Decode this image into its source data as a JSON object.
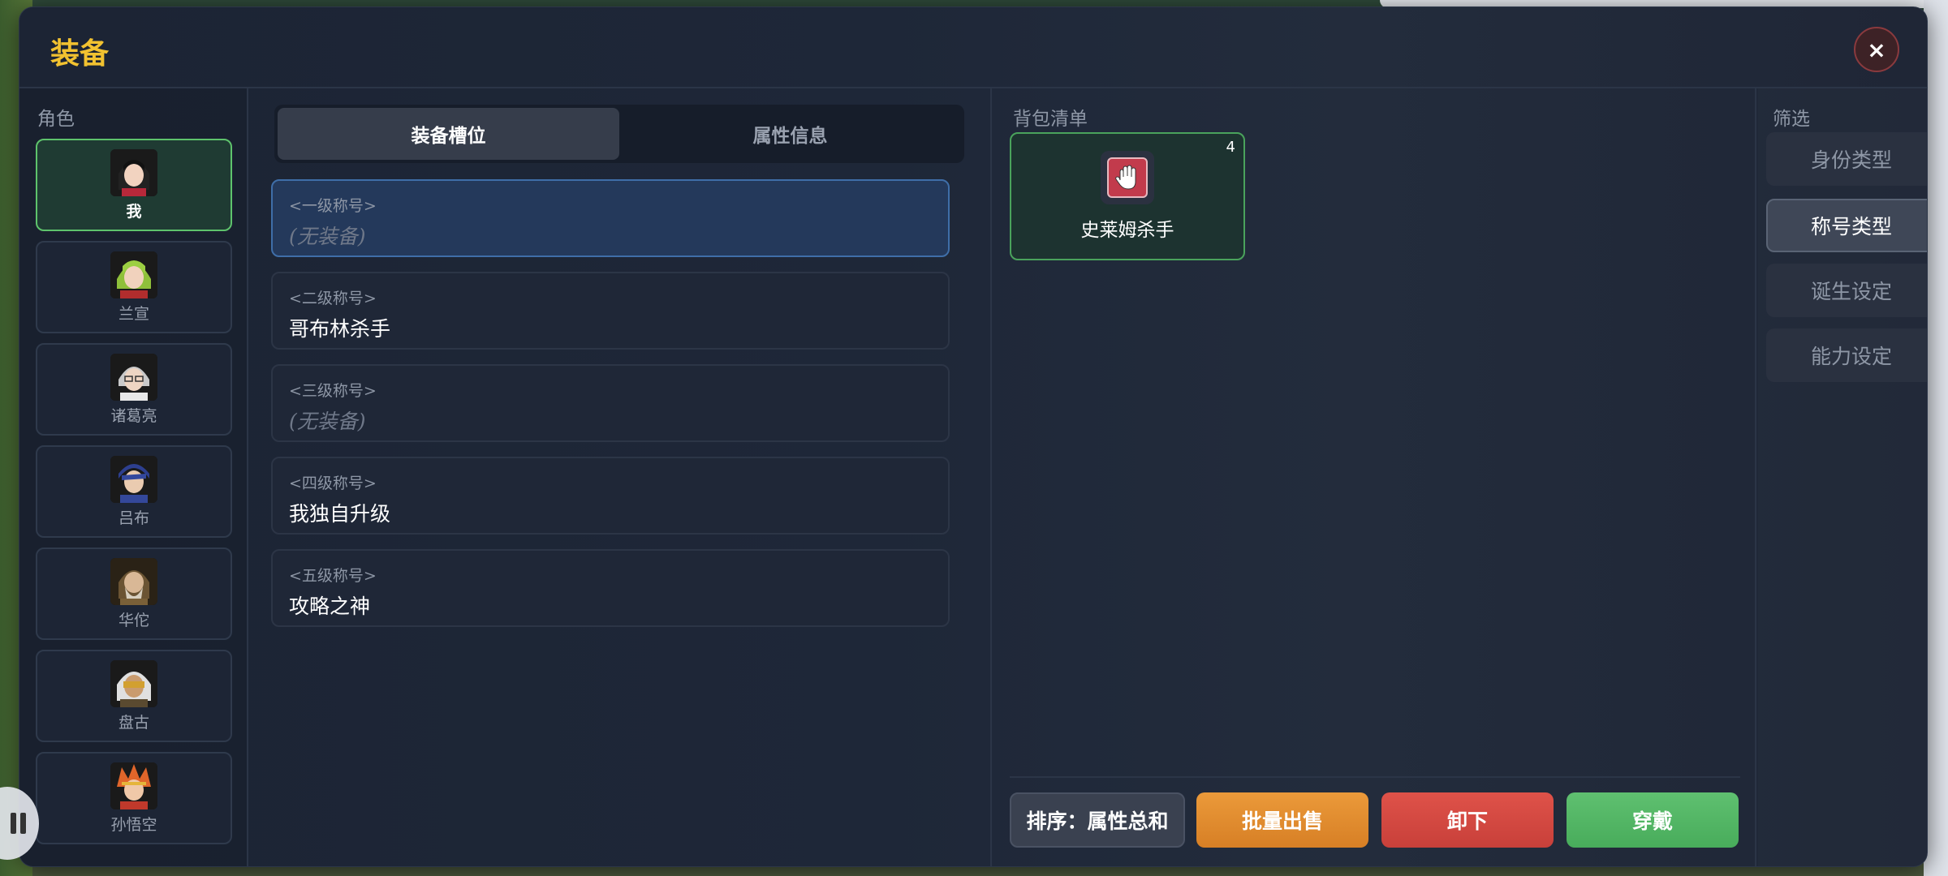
{
  "dialog": {
    "title": "装备",
    "close_label": "×"
  },
  "roles": {
    "label": "角色",
    "items": [
      {
        "name": "我",
        "active": true
      },
      {
        "name": "兰宣",
        "active": false
      },
      {
        "name": "诸葛亮",
        "active": false
      },
      {
        "name": "吕布",
        "active": false
      },
      {
        "name": "华佗",
        "active": false
      },
      {
        "name": "盘古",
        "active": false
      },
      {
        "name": "孙悟空",
        "active": false
      }
    ]
  },
  "tabs": [
    {
      "label": "装备槽位",
      "active": true
    },
    {
      "label": "属性信息",
      "active": false
    }
  ],
  "slots": [
    {
      "level": "<一级称号>",
      "value": "(无装备)",
      "empty": true,
      "selected": true
    },
    {
      "level": "<二级称号>",
      "value": "哥布林杀手",
      "empty": false
    },
    {
      "level": "<三级称号>",
      "value": "(无装备)",
      "empty": true
    },
    {
      "level": "<四级称号>",
      "value": "我独自升级",
      "empty": false
    },
    {
      "level": "<五级称号>",
      "value": "攻略之神",
      "empty": false
    }
  ],
  "bag": {
    "label": "背包清单",
    "items": [
      {
        "name": "史莱姆杀手",
        "count": "4",
        "icon": "glove-icon"
      }
    ]
  },
  "actions": {
    "sort_label": "排序：属性总和",
    "sell_label": "批量出售",
    "unequip_label": "卸下",
    "equip_label": "穿戴"
  },
  "filter": {
    "label": "筛选",
    "items": [
      {
        "label": "身份类型",
        "active": false
      },
      {
        "label": "称号类型",
        "active": true
      },
      {
        "label": "诞生设定",
        "active": false
      },
      {
        "label": "能力设定",
        "active": false
      }
    ]
  },
  "colors": {
    "title": "#f2c230",
    "active_role_border": "#5ec36c",
    "selected_slot_border": "#3f6ea8",
    "sell": "#e08a2e",
    "unequip": "#d4463f",
    "equip": "#55b666"
  }
}
